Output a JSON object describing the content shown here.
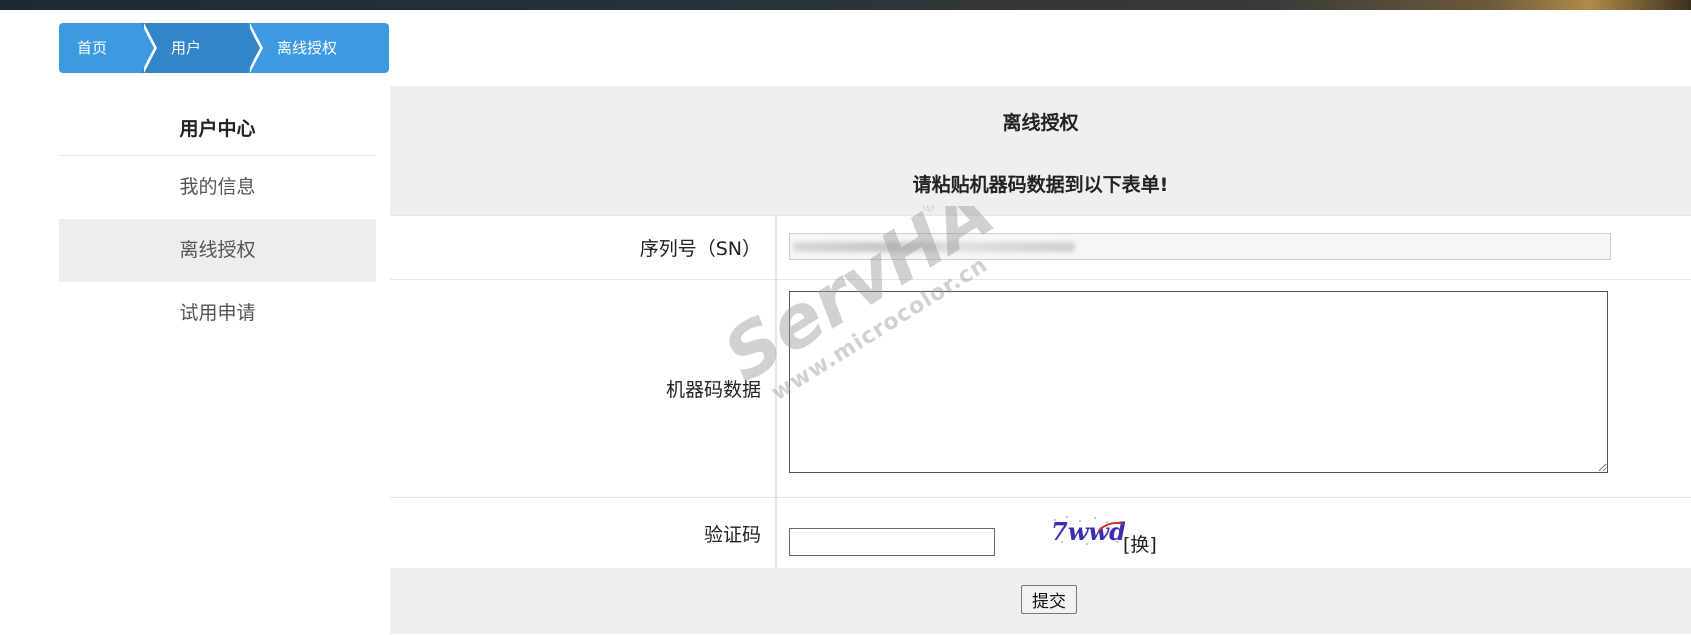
{
  "breadcrumb": {
    "items": [
      {
        "label": "首页"
      },
      {
        "label": "用户"
      },
      {
        "label": "离线授权"
      }
    ]
  },
  "sidebar": {
    "title": "用户中心",
    "items": [
      {
        "label": "我的信息",
        "active": false
      },
      {
        "label": "离线授权",
        "active": true
      },
      {
        "label": "试用申请",
        "active": false
      }
    ]
  },
  "panel": {
    "title": "离线授权",
    "subtitle": "请粘贴机器码数据到以下表单!",
    "sn_label": "序列号（SN）",
    "machine_code_label": "机器码数据",
    "captcha_label": "验证码",
    "captcha_text": "7wwd",
    "captcha_refresh": "[换]",
    "submit_label": "提交"
  },
  "watermark": {
    "brand": "ServHA",
    "registered": "®",
    "url": "www.microcolor.cn"
  },
  "colors": {
    "breadcrumb_primary": "#3b9ae0",
    "breadcrumb_secondary": "#3286c7",
    "panel_bg": "#efefef",
    "sidebar_active_bg": "#ededed"
  }
}
